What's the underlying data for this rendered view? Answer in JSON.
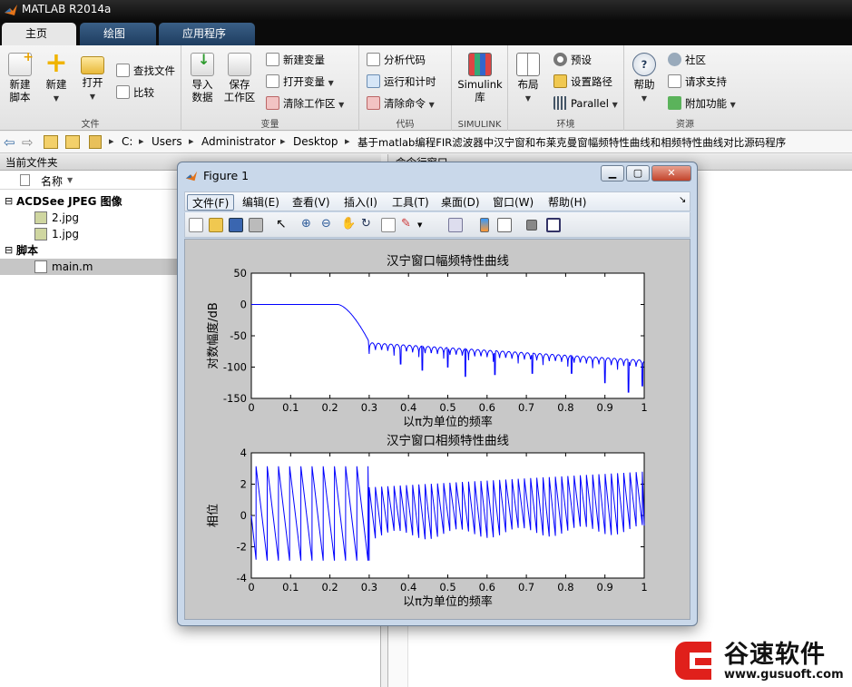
{
  "app": {
    "title": "MATLAB R2014a"
  },
  "tabs": [
    {
      "label": "主页",
      "active": true
    },
    {
      "label": "绘图",
      "active": false
    },
    {
      "label": "应用程序",
      "active": false
    }
  ],
  "ribbon": {
    "groups": {
      "file": "文件",
      "variable": "变量",
      "code": "代码",
      "simulink": "SIMULINK",
      "environment": "环境",
      "resources": "资源"
    },
    "new_script": [
      "新建",
      "脚本"
    ],
    "new": "新建",
    "open": "打开",
    "find_files": "查找文件",
    "compare": "比较",
    "import_data": [
      "导入",
      "数据"
    ],
    "save_workspace": [
      "保存",
      "工作区"
    ],
    "new_variable": "新建变量",
    "open_variable": "打开变量",
    "clear_workspace": "清除工作区",
    "analyze_code": "分析代码",
    "run_and_time": "运行和计时",
    "clear_commands": "清除命令",
    "simulink_library": [
      "Simulink",
      "库"
    ],
    "layout": "布局",
    "preferences": "预设",
    "set_path": "设置路径",
    "parallel": "Parallel",
    "help": "帮助",
    "community": "社区",
    "request_support": "请求支持",
    "add_ons": "附加功能"
  },
  "address": {
    "crumbs": [
      "C:",
      "Users",
      "Administrator",
      "Desktop",
      "基于matlab编程FIR滤波器中汉宁窗和布莱克曼窗幅频特性曲线和相频特性曲线对比源码程序"
    ]
  },
  "current_folder": {
    "title": "当前文件夹",
    "column_name": "名称",
    "groups": [
      {
        "label": "ACDSee JPEG 图像",
        "files": [
          "2.jpg",
          "1.jpg"
        ]
      },
      {
        "label": "脚本",
        "files": [
          "main.m"
        ]
      }
    ],
    "selected": "main.m"
  },
  "command_window": {
    "title": "命令行窗口"
  },
  "figure": {
    "title": "Figure 1",
    "menu": [
      "文件(F)",
      "编辑(E)",
      "查看(V)",
      "插入(I)",
      "工具(T)",
      "桌面(D)",
      "窗口(W)",
      "帮助(H)"
    ]
  },
  "chart_data": [
    {
      "type": "line",
      "title": "汉宁窗口幅频特性曲线",
      "xlabel": "以π为单位的频率",
      "ylabel": "对数幅度/dB",
      "xlim": [
        0,
        1
      ],
      "ylim": [
        -150,
        50
      ],
      "xticks": [
        "0",
        "0.1",
        "0.2",
        "0.3",
        "0.4",
        "0.5",
        "0.6",
        "0.7",
        "0.8",
        "0.9",
        "1"
      ],
      "yticks": [
        "50",
        "0",
        "-50",
        "-100",
        "-150"
      ],
      "series_color": "#0000ff",
      "passband": {
        "x_end": 0.22,
        "y": 0
      },
      "transition": {
        "x_start": 0.22,
        "x_end": 0.3,
        "y_end": -60
      },
      "stopband_envelope": {
        "x": [
          0.3,
          1.0
        ],
        "y": [
          -57,
          -85
        ]
      },
      "stopband_nulls": [
        {
          "x": 0.38,
          "y": -95
        },
        {
          "x": 0.435,
          "y": -105
        },
        {
          "x": 0.5,
          "y": -100
        },
        {
          "x": 0.545,
          "y": -115
        },
        {
          "x": 0.62,
          "y": -112
        },
        {
          "x": 0.715,
          "y": -110
        },
        {
          "x": 0.815,
          "y": -110
        },
        {
          "x": 0.9,
          "y": -125
        },
        {
          "x": 0.96,
          "y": -140
        },
        {
          "x": 0.995,
          "y": -130
        }
      ],
      "grid": false
    },
    {
      "type": "line",
      "title": "汉宁窗口相频特性曲线",
      "xlabel": "以π为单位的频率",
      "ylabel": "相位",
      "xlim": [
        0,
        1
      ],
      "ylim": [
        -4,
        4
      ],
      "xticks": [
        "0",
        "0.1",
        "0.2",
        "0.3",
        "0.4",
        "0.5",
        "0.6",
        "0.7",
        "0.8",
        "0.9",
        "1"
      ],
      "yticks": [
        "4",
        "2",
        "0",
        "-2",
        "-4"
      ],
      "series_color": "#0000ff",
      "passband_wraps": {
        "x_end": 0.3,
        "period": 0.0285,
        "amplitude": 3.14
      },
      "stopband_wraps": {
        "x_start": 0.3,
        "period": 0.0158,
        "y_low_start": -0.5,
        "y_low_end": -0.1,
        "y_high_start": 1.8,
        "y_high_end": 2.8
      },
      "grid": false
    }
  ],
  "watermark": {
    "name": "谷速软件",
    "url": "www.gusuoft.com"
  },
  "colors": {
    "accent": "#1e3d60",
    "line": "#0000ff",
    "watermark_red": "#e0201b"
  }
}
